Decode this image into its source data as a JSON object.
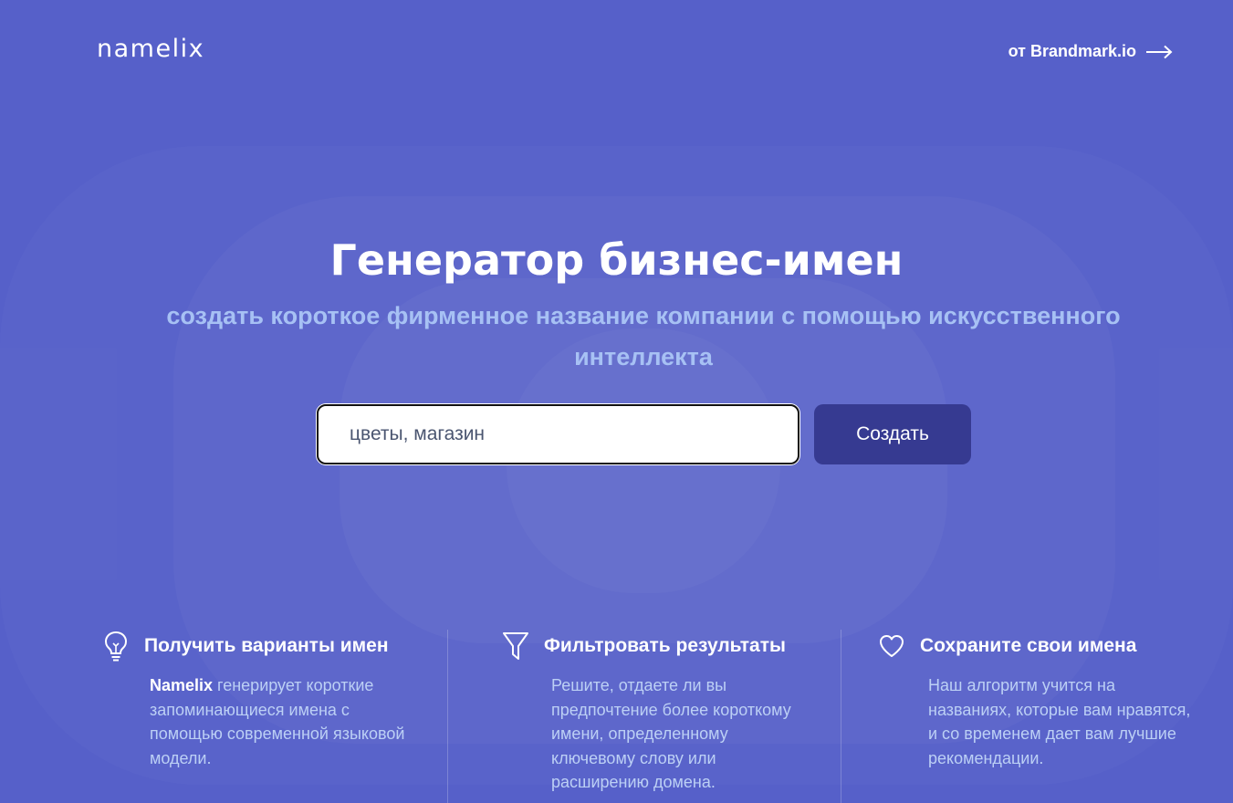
{
  "header": {
    "logo": "namelix",
    "by_link": "от Brandmark.io"
  },
  "hero": {
    "title": "Генератор бизнес-имен",
    "subtitle": "создать короткое фирменное название компании с помощью искусственного интеллекта"
  },
  "search": {
    "value": "цветы, магазин",
    "button_label": "Создать"
  },
  "features": [
    {
      "icon": "lightbulb-icon",
      "title": "Получить варианты имен",
      "text_bold": "Namelix",
      "text": " генерирует короткие запоминающиеся имена с помощью современной языковой модели."
    },
    {
      "icon": "filter-icon",
      "title": "Фильтровать результаты",
      "text": "Решите, отдаете ли вы предпочтение более короткому имени, определенному ключевому слову или расширению домена."
    },
    {
      "icon": "heart-icon",
      "title": "Сохраните свои имена",
      "text": "Наш алгоритм учится на названиях, которые вам нравятся, и со временем дает вам лучшие рекомендации."
    }
  ],
  "colors": {
    "background": "#5660c9",
    "accent_text": "#a7c1f4",
    "button": "#363a91"
  }
}
